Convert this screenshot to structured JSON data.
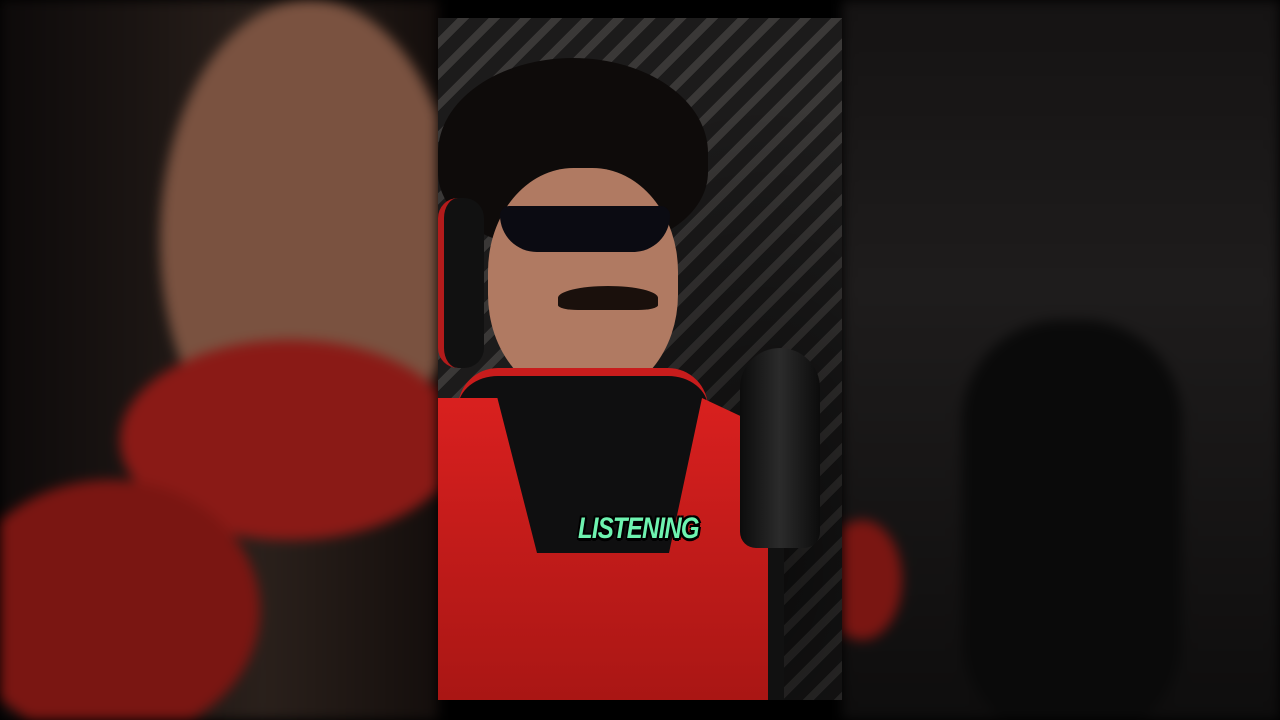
{
  "video": {
    "caption": "LISTENING"
  },
  "colors": {
    "caption": "#6ef3b0",
    "vest": "#d9201f"
  }
}
